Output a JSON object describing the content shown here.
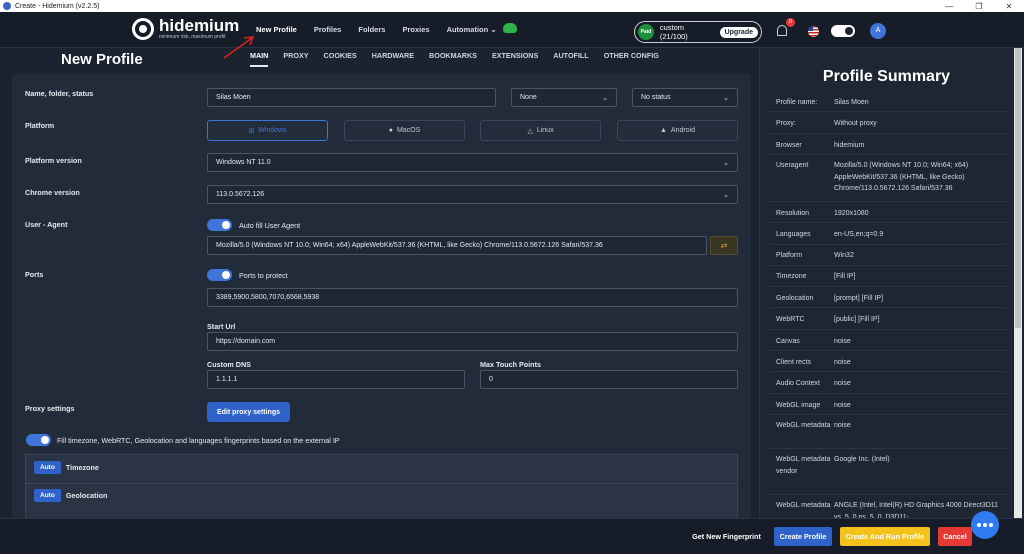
{
  "window": {
    "title": "Create - Hidemium (v2.2.5)"
  },
  "brand": {
    "name": "hidemium",
    "tagline": "minimum risk, maximum profit"
  },
  "nav": {
    "new_profile": "New Profile",
    "profiles": "Profiles",
    "folders": "Folders",
    "proxies": "Proxies",
    "automation": "Automation"
  },
  "plan": {
    "badge": "Paid",
    "label": "custom (21/100)",
    "upgrade": "Upgrade"
  },
  "notifications": {
    "count": "0"
  },
  "user": {
    "initial": "A"
  },
  "page": {
    "title": "New Profile"
  },
  "tabs": [
    "MAIN",
    "PROXY",
    "COOKIES",
    "HARDWARE",
    "BOOKMARKS",
    "EXTENSIONS",
    "AUTOFILL",
    "OTHER CONFIG"
  ],
  "form": {
    "name_label": "Name, folder, status",
    "name_value": "Silas Moen",
    "folder_value": "None",
    "status_value": "No status",
    "platform_label": "Platform",
    "platforms": [
      "Windows",
      "MacOS",
      "Linux",
      "Android"
    ],
    "platform_version_label": "Platform version",
    "platform_version_value": "Windows NT 11.0",
    "chrome_version_label": "Chrome version",
    "chrome_version_value": "113.0.5672.126",
    "ua_label": "User - Agent",
    "ua_toggle_label": "Auto fill User Agent",
    "ua_value": "Mozilla/5.0 (Windows NT 10.0; Win64; x64) AppleWebKit/537.36 (KHTML, like Gecko) Chrome/113.0.5672.126 Safari/537.36",
    "ports_label": "Ports",
    "ports_toggle_label": "Ports to protect",
    "ports_value": "3389,5900,5800,7070,6568,5938",
    "start_url_label": "Start Url",
    "start_url_value": "https://domain.com",
    "dns_label": "Custom DNS",
    "dns_value": "1.1.1.1",
    "touch_label": "Max Touch Points",
    "touch_value": "0",
    "proxy_label": "Proxy settings",
    "proxy_button": "Edit proxy settings",
    "fill_toggle_label": "Fill timezone, WebRTC, Geolocation and languages fingerprints based on the external IP",
    "accordion": [
      {
        "badge": "Auto",
        "label": "Timezone"
      },
      {
        "badge": "Auto",
        "label": "Geolocation"
      }
    ]
  },
  "summary": {
    "title": "Profile Summary",
    "rows": [
      {
        "key": "Profile name:",
        "value": "Silas Moen"
      },
      {
        "key": "Proxy:",
        "value": "Without proxy"
      },
      {
        "key": "Browser",
        "value": "hidemium"
      },
      {
        "key": "Useragent",
        "value": "Mozilla/5.0 (Windows NT 10.0; Win64; x64) AppleWebKit/537.36 (KHTML, like Gecko) Chrome/113.0.5672.126 Safari/537.36"
      },
      {
        "key": "Resolution",
        "value": "1920x1080"
      },
      {
        "key": "Languages",
        "value": "en-US,en;q=0.9"
      },
      {
        "key": "Platform",
        "value": "Win32"
      },
      {
        "key": "Timezone",
        "value": "[Fill IP]"
      },
      {
        "key": "Geolocation",
        "value": "[prompt] [Fill IP]"
      },
      {
        "key": "WebRTC",
        "value": "[public] [Fill IP]"
      },
      {
        "key": "Canvas",
        "value": "noise"
      },
      {
        "key": "Client rects",
        "value": "noise"
      },
      {
        "key": "Audio Context",
        "value": "noise"
      },
      {
        "key": "WebGL image",
        "value": "noise"
      },
      {
        "key": "WebGL metadata",
        "value": "noise"
      },
      {
        "key": "WebGL metadata vendor",
        "value": "Google Inc. (Intel)"
      },
      {
        "key": "WebGL metadata",
        "value": "ANGLE (Intel, Intel(R) HD Graphics 4000 Direct3D11 vs_5_0 ps_5_0, D3D11-"
      }
    ]
  },
  "footer": {
    "new_fingerprint": "Get New Fingerprint",
    "create": "Create Profile",
    "create_run": "Create And Run Profile",
    "cancel": "Cancel"
  },
  "colors": {
    "accent": "#2f63c9",
    "yellow": "#f4c21b",
    "red": "#e53935",
    "background": "#1b2230"
  }
}
